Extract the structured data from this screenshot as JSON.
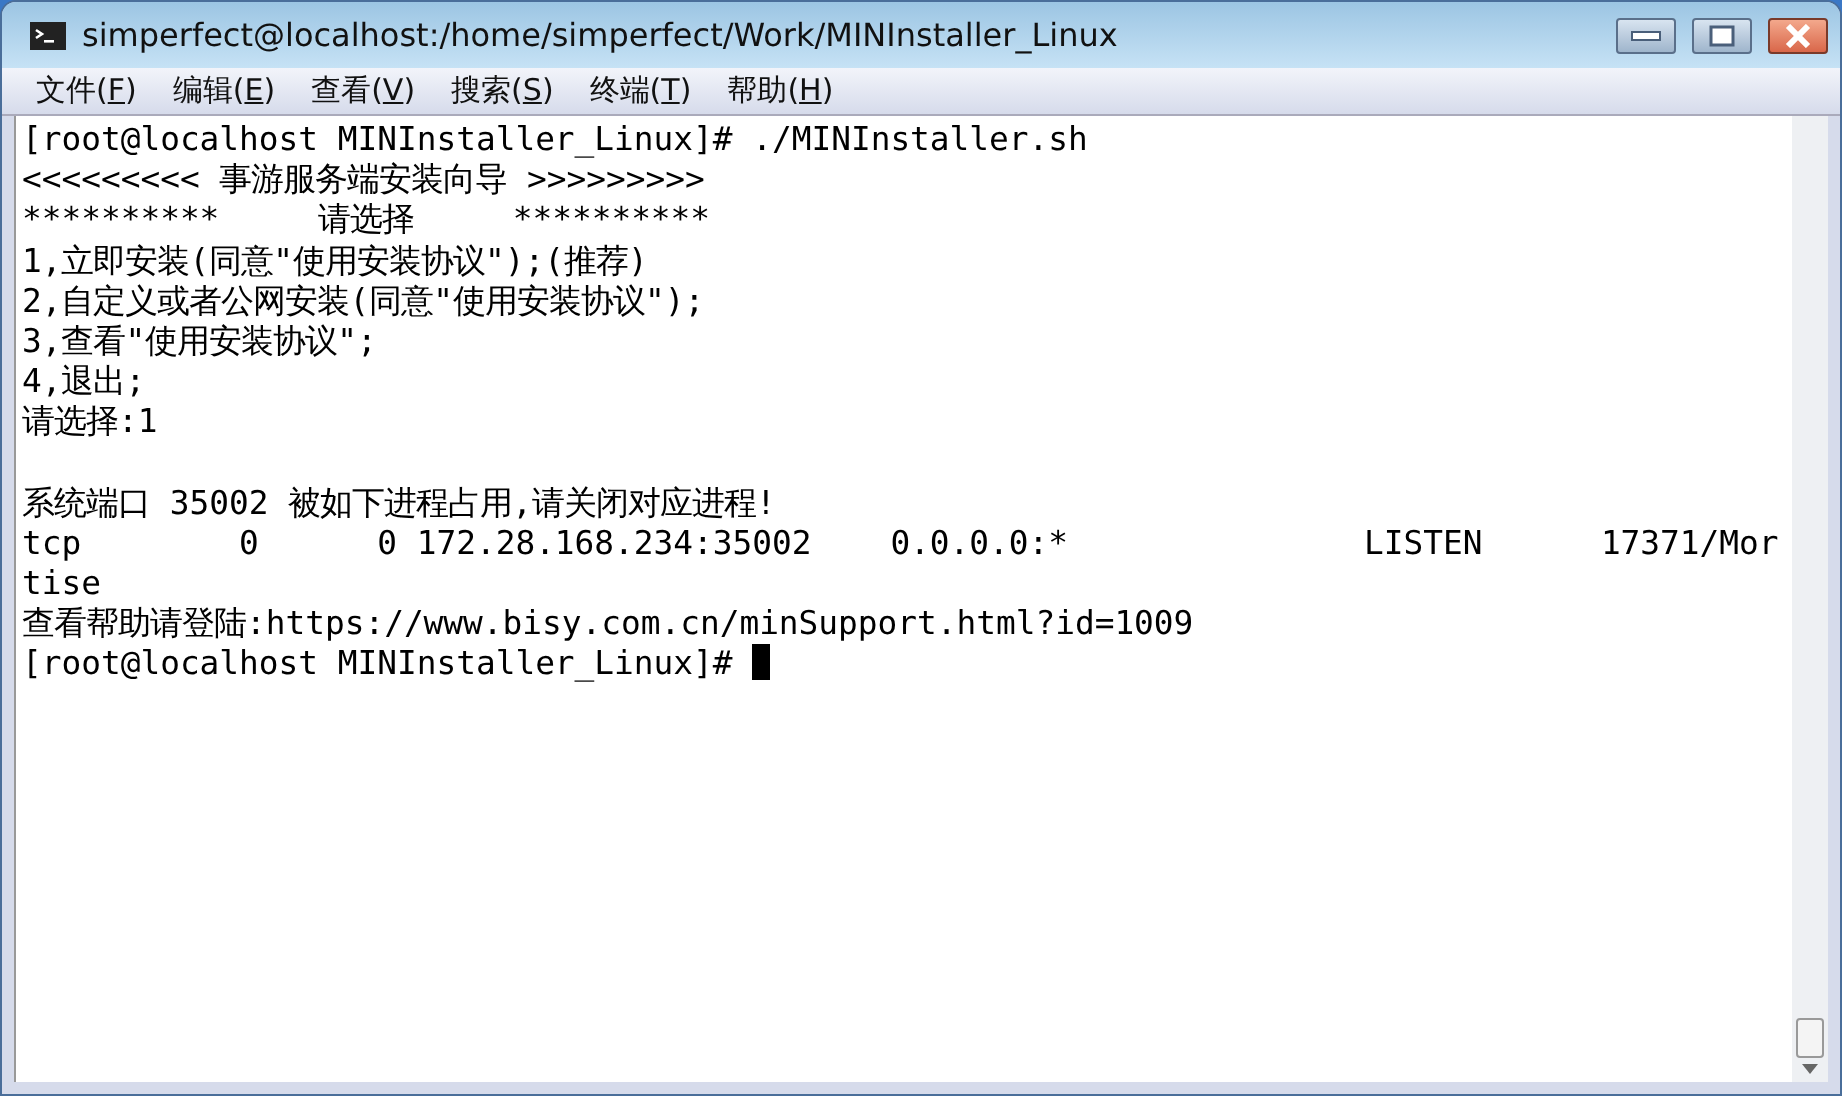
{
  "window": {
    "title": "simperfect@localhost:/home/simperfect/Work/MINInstaller_Linux"
  },
  "menu": [
    {
      "label": "文件(F)"
    },
    {
      "label": "编辑(E)"
    },
    {
      "label": "查看(V)"
    },
    {
      "label": "搜索(S)"
    },
    {
      "label": "终端(T)"
    },
    {
      "label": "帮助(H)"
    }
  ],
  "terminal": {
    "lines": [
      {
        "kind": "text",
        "text": "[root@localhost MINInstaller_Linux]# ./MINInstaller.sh"
      },
      {
        "kind": "text",
        "text": "<<<<<<<<< 事游服务端安装向导 >>>>>>>>>"
      },
      {
        "kind": "text",
        "text": "**********     请选择     **********"
      },
      {
        "kind": "text",
        "text": "1,立即安装(同意\"使用安装协议\");(推荐)"
      },
      {
        "kind": "text",
        "text": "2,自定义或者公网安装(同意\"使用安装协议\");"
      },
      {
        "kind": "text",
        "text": "3,查看\"使用安装协议\";"
      },
      {
        "kind": "text",
        "text": "4,退出;"
      },
      {
        "kind": "text",
        "text": "请选择:1"
      },
      {
        "kind": "blank"
      },
      {
        "kind": "text",
        "text": "系统端口 35002 被如下进程占用,请关闭对应进程!"
      },
      {
        "kind": "text",
        "text": "tcp        0      0 172.28.168.234:35002    0.0.0.0:*               LISTEN      17371/Mor"
      },
      {
        "kind": "text",
        "text": "tise"
      },
      {
        "kind": "text",
        "text": "查看帮助请登陆:https://www.bisy.com.cn/minSupport.html?id=1009"
      },
      {
        "kind": "prompt",
        "text": "[root@localhost MINInstaller_Linux]# "
      }
    ]
  }
}
